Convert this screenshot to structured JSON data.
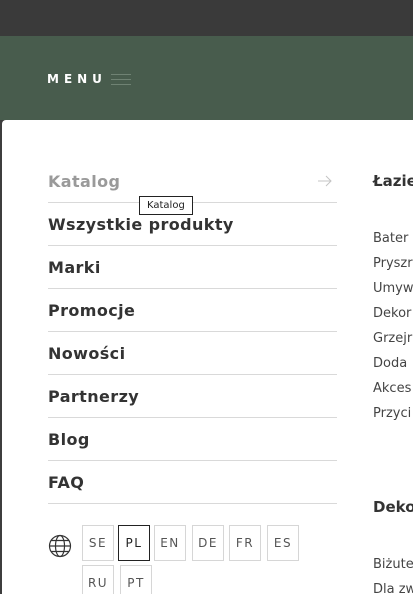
{
  "header": {
    "menu_label": "MENU"
  },
  "nav": {
    "items": [
      {
        "label": "Katalog"
      },
      {
        "label": "Wszystkie produkty"
      },
      {
        "label": "Marki"
      },
      {
        "label": "Promocje"
      },
      {
        "label": "Nowości"
      },
      {
        "label": "Partnerzy"
      },
      {
        "label": "Blog"
      },
      {
        "label": "FAQ"
      }
    ],
    "tooltip": "Katalog"
  },
  "languages": {
    "items": [
      "SE",
      "PL",
      "EN",
      "DE",
      "FR",
      "ES",
      "RU",
      "PT"
    ],
    "active": "PL"
  },
  "columns": [
    {
      "title": "Łazie",
      "links": [
        "Bater",
        "Pryszr",
        "Umyw",
        "Dekor",
        "Grzejr",
        "Doda",
        "Akces",
        "Przyci"
      ]
    },
    {
      "title": "Deko",
      "links": [
        "Biżute",
        "Dla zw"
      ]
    }
  ],
  "colors": {
    "header_bg": "#485c4d",
    "topbar_bg": "#3a3a3a",
    "panel_bg": "#ffffff"
  }
}
